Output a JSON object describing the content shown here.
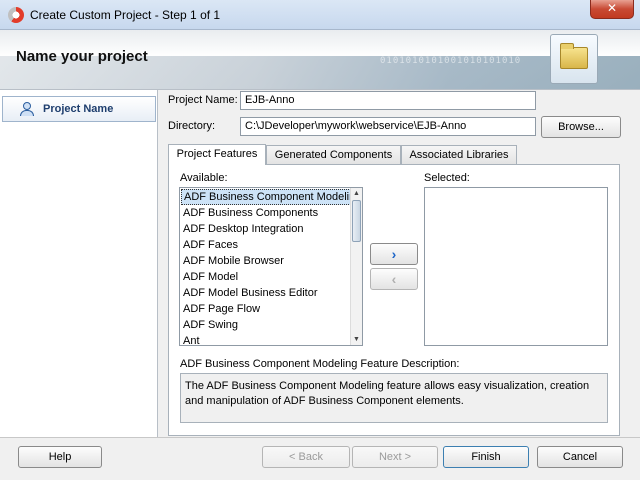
{
  "window": {
    "title": "Create Custom Project - Step 1 of 1",
    "close_label": "✕"
  },
  "header": {
    "heading": "Name your project",
    "binary_text": "0101010101001010101010"
  },
  "nav": {
    "items": [
      {
        "label": "Project Name"
      }
    ]
  },
  "form": {
    "project_name_label": "Project Name:",
    "project_name_value": "EJB-Anno",
    "directory_label": "Directory:",
    "directory_value": "C:\\JDeveloper\\mywork\\webservice\\EJB-Anno",
    "browse_label": "Browse..."
  },
  "tabs": [
    {
      "label": "Project Features"
    },
    {
      "label": "Generated Components"
    },
    {
      "label": "Associated Libraries"
    }
  ],
  "features": {
    "available_label": "Available:",
    "selected_label": "Selected:",
    "available_items": [
      "ADF Business Component Modeling",
      "ADF Business Components",
      "ADF Desktop Integration",
      "ADF Faces",
      "ADF Mobile Browser",
      "ADF Model",
      "ADF Model Business Editor",
      "ADF Page Flow",
      "ADF Swing",
      "Ant"
    ],
    "add_label": "›",
    "remove_label": "‹",
    "description_title": "ADF Business Component Modeling Feature Description:",
    "description_text": "The ADF Business Component Modeling feature allows easy visualization, creation and manipulation of ADF Business Component elements."
  },
  "buttons": {
    "help": "Help",
    "back": "< Back",
    "next": "Next >",
    "finish": "Finish",
    "cancel": "Cancel"
  }
}
